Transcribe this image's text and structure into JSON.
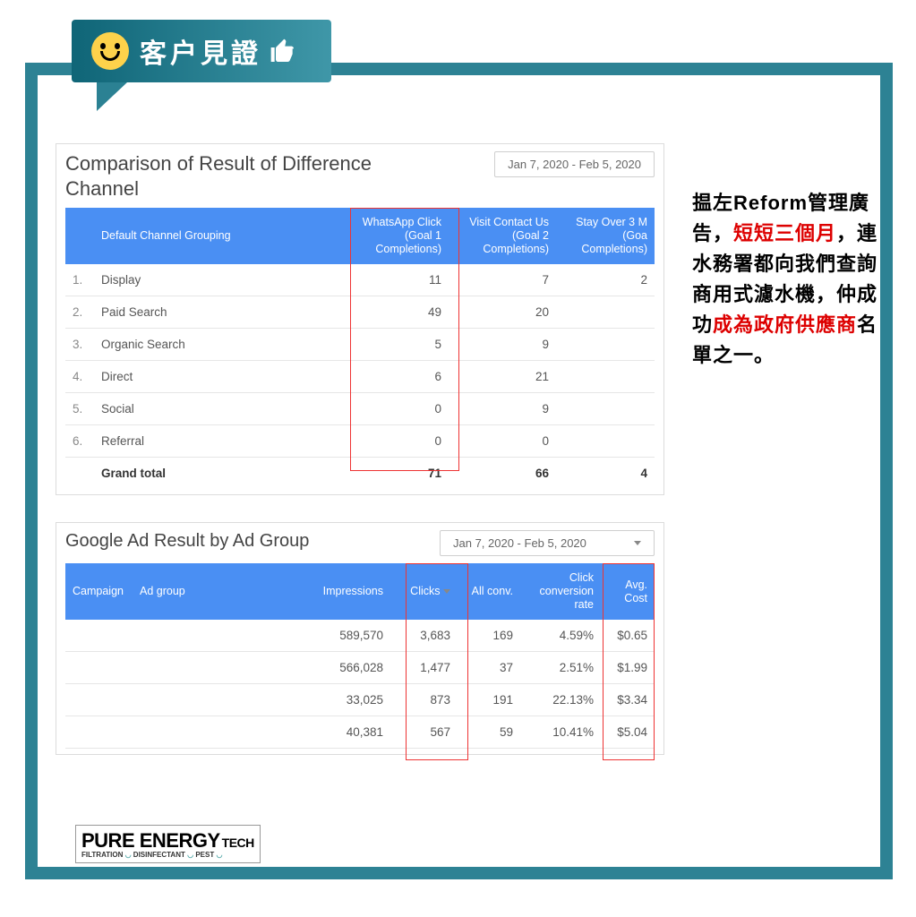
{
  "header": {
    "title": "客户見證"
  },
  "panel1": {
    "title": "Comparison of Result of Difference Channel",
    "date_range": "Jan 7, 2020 - Feb 5, 2020",
    "head": {
      "c1": "Default Channel Grouping",
      "c2": "WhatsApp Click (Goal 1 Completions)",
      "c3": "Visit Contact Us (Goal 2 Completions)",
      "c4": "Stay Over 3 M (Goa Completions)"
    },
    "rows": [
      {
        "n": "1.",
        "name": "Display",
        "a": "11",
        "b": "7",
        "c": "2"
      },
      {
        "n": "2.",
        "name": "Paid Search",
        "a": "49",
        "b": "20",
        "c": ""
      },
      {
        "n": "3.",
        "name": "Organic Search",
        "a": "5",
        "b": "9",
        "c": ""
      },
      {
        "n": "4.",
        "name": "Direct",
        "a": "6",
        "b": "21",
        "c": ""
      },
      {
        "n": "5.",
        "name": "Social",
        "a": "0",
        "b": "9",
        "c": ""
      },
      {
        "n": "6.",
        "name": "Referral",
        "a": "0",
        "b": "0",
        "c": ""
      }
    ],
    "total": {
      "label": "Grand total",
      "a": "71",
      "b": "66",
      "c": "4"
    }
  },
  "panel2": {
    "title": "Google Ad Result by Ad Group",
    "date_range": "Jan 7, 2020 - Feb 5, 2020",
    "head": {
      "c1": "Campaign",
      "c2": "Ad group",
      "c3": "Impressions",
      "c4": "Clicks",
      "c5": "All conv.",
      "c6": "Click conversion rate",
      "c7": "Avg. Cost"
    },
    "rows": [
      {
        "imp": "589,570",
        "clk": "3,683",
        "conv": "169",
        "rate": "4.59%",
        "cost": "$0.65"
      },
      {
        "imp": "566,028",
        "clk": "1,477",
        "conv": "37",
        "rate": "2.51%",
        "cost": "$1.99"
      },
      {
        "imp": "33,025",
        "clk": "873",
        "conv": "191",
        "rate": "22.13%",
        "cost": "$3.34"
      },
      {
        "imp": "40,381",
        "clk": "567",
        "conv": "59",
        "rate": "10.41%",
        "cost": "$5.04"
      }
    ]
  },
  "testimonial": {
    "t1": "揾左Reform管理廣告，",
    "r1": "短短三個月",
    "t2": "，連水務署都向我們查詢商用式濾水機，仲成功",
    "r2": "成為政府供應商",
    "t3": "名單之一。"
  },
  "logo": {
    "main": "PURE ENERGY",
    "tech": "TECH",
    "sub1": "FILTRATION",
    "sub2": "DISINFECTANT",
    "sub3": "PEST"
  }
}
